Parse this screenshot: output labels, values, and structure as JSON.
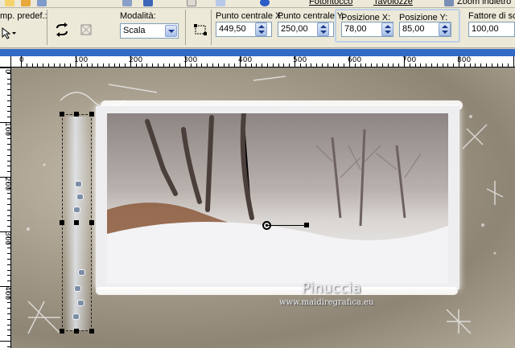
{
  "menu": {
    "item_fotoritocco": "Fotoritocco",
    "item_tavolozze": "Tavolozze",
    "item_zoom": "Zoom indietro"
  },
  "tool_options": {
    "preset_label": "mp. predef.:",
    "mode_label": "Modalità:",
    "mode_value": "Scala",
    "center_x_label": "Punto centrale X:",
    "center_x_value": "449,50",
    "center_y_label": "Punto centrale Y:",
    "center_y_value": "250,00",
    "pos_x_label": "Posizione X:",
    "pos_x_value": "78,00",
    "pos_y_label": "Posizione Y:",
    "pos_y_value": "85,00",
    "scale_label": "Fattore di scala",
    "scale_value": "100,00"
  },
  "ruler": {
    "h_labels": [
      "0",
      "100",
      "200",
      "300",
      "400",
      "500",
      "600",
      "700",
      "800"
    ],
    "v_labels": [
      "0",
      "100",
      "200",
      "300",
      "400"
    ]
  },
  "canvas": {
    "watermark_title": "Pinuccia",
    "watermark_url": "www.maidiregrafica.eu"
  },
  "colors": {
    "selection_box": "#316ac5",
    "spin_arrow": "#1d3a8a",
    "field_border": "#7f9db9"
  }
}
